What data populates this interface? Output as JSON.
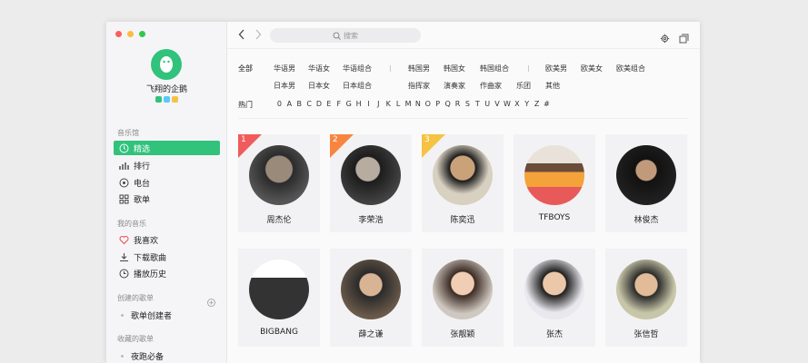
{
  "user": {
    "name": "飞翔的企鹅"
  },
  "sidebar": {
    "section_music_hall": "音乐馆",
    "music_hall_items": [
      {
        "label": "精选",
        "icon": "disc-icon"
      },
      {
        "label": "排行",
        "icon": "chart-bars-icon"
      },
      {
        "label": "电台",
        "icon": "radio-icon"
      },
      {
        "label": "歌单",
        "icon": "grid-icon"
      }
    ],
    "section_my_music": "我的音乐",
    "my_music_items": [
      {
        "label": "我喜欢",
        "icon": "heart-icon"
      },
      {
        "label": "下载歌曲",
        "icon": "download-icon"
      },
      {
        "label": "播放历史",
        "icon": "clock-icon"
      }
    ],
    "section_created": "创建的歌单",
    "created_items": [
      {
        "label": "歌单创建者"
      }
    ],
    "section_collected": "收藏的歌单",
    "collected_items": [
      {
        "label": "夜跑必备"
      }
    ]
  },
  "search": {
    "placeholder": "搜索"
  },
  "filters": {
    "all_label": "全部",
    "row1": [
      "华语男",
      "华语女",
      "华语组合",
      "韩国男",
      "韩国女",
      "韩国组合",
      "欧美男",
      "欧美女",
      "欧美组合"
    ],
    "row2": [
      "日本男",
      "日本女",
      "日本组合",
      "指挥家",
      "演奏家",
      "作曲家",
      "乐团",
      "其他"
    ],
    "hot_label": "热门",
    "alphabet": [
      "0",
      "A",
      "B",
      "C",
      "D",
      "E",
      "F",
      "G",
      "H",
      "I",
      "J",
      "K",
      "L",
      "M",
      "N",
      "O",
      "P",
      "Q",
      "R",
      "S",
      "T",
      "U",
      "V",
      "W",
      "X",
      "Y",
      "Z",
      "#"
    ]
  },
  "singers": [
    {
      "name": "周杰伦",
      "rank": "1",
      "rank_color": "#f15b5b"
    },
    {
      "name": "李荣浩",
      "rank": "2",
      "rank_color": "#f7853f"
    },
    {
      "name": "陈奕迅",
      "rank": "3",
      "rank_color": "#f5c343"
    },
    {
      "name": "TFBOYS"
    },
    {
      "name": "林俊杰"
    },
    {
      "name": "BIGBANG"
    },
    {
      "name": "薛之谦"
    },
    {
      "name": "张靓颖"
    },
    {
      "name": "张杰"
    },
    {
      "name": "张信哲"
    }
  ],
  "colors": {
    "accent": "#31c27c"
  }
}
